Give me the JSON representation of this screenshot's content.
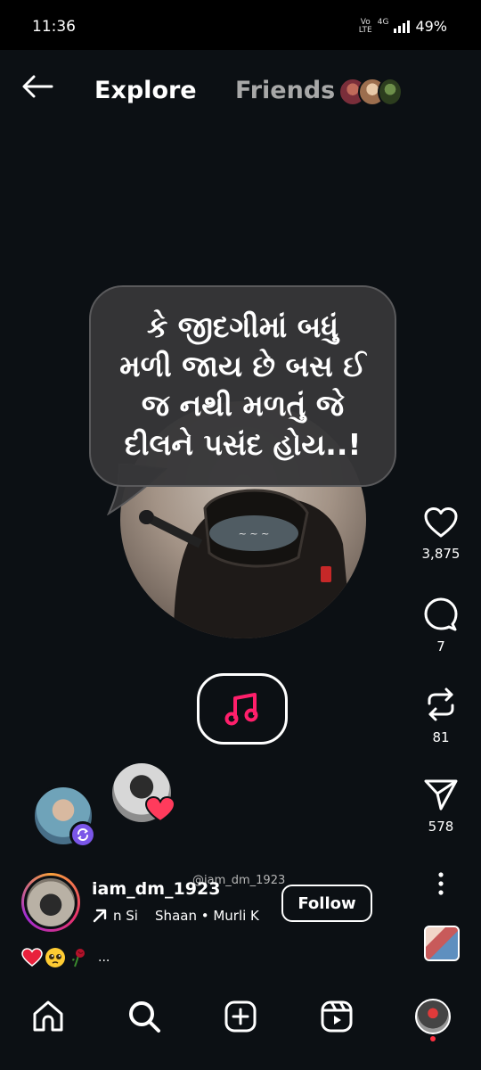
{
  "status_bar": {
    "time": "11:36",
    "network_top": "Vo",
    "network_bottom": "LTE",
    "net_type": "4G",
    "battery": "49%"
  },
  "header": {
    "tabs": [
      {
        "label": "Explore",
        "active": true
      },
      {
        "label": "Friends",
        "active": false
      }
    ]
  },
  "post": {
    "quote_lines": [
      "કે જીદગીમાં બધું",
      "મળી જાય છે બસ ઈ",
      "જ નથી મળતું જે",
      "દીલને પસંદ હોય..!"
    ],
    "watermark": "@iam_dm_1923",
    "author": "iam_dm_1923",
    "audio_text": "n Si    Shaan • Murli K",
    "follow_label": "Follow",
    "caption_more": "...",
    "caption_emojis": [
      "heart-emoji",
      "pleading-face-emoji",
      "wilted-rose-emoji"
    ]
  },
  "actions": {
    "likes": "3,875",
    "comments": "7",
    "reposts": "81",
    "shares": "578"
  },
  "icons": {
    "back": "back-arrow-icon",
    "like": "heart-icon",
    "comment": "comment-icon",
    "repost": "repost-icon",
    "share": "send-icon",
    "more": "more-vertical-icon",
    "music": "music-note-icon",
    "nav": [
      "home-icon",
      "search-icon",
      "create-icon",
      "reels-icon",
      "profile-avatar"
    ]
  },
  "colors": {
    "background": "#0c1014",
    "music_accent": "#ff1f6b",
    "badge_purple": "#7a56e8",
    "heart_red": "#ff3040"
  }
}
